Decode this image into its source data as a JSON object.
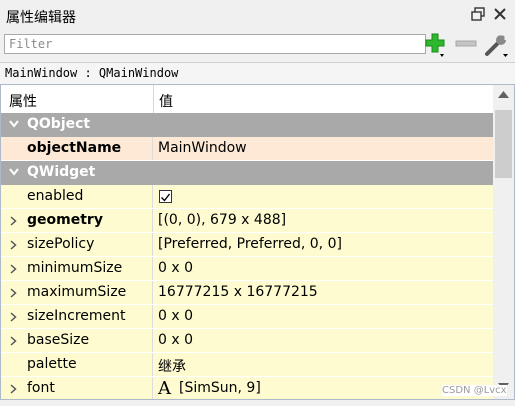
{
  "window": {
    "title": "属性编辑器"
  },
  "toolbar": {
    "filter_placeholder": "Filter"
  },
  "class_path": "MainWindow : QMainWindow",
  "columns": {
    "property": "属性",
    "value": "值"
  },
  "groups": [
    {
      "name": "QObject",
      "items": [
        {
          "name": "objectName",
          "value": "MainWindow",
          "bold": true,
          "expandable": false,
          "bg": "#fde9d6"
        }
      ]
    },
    {
      "name": "QWidget",
      "items": [
        {
          "name": "enabled",
          "value": "",
          "checked": true,
          "bold": false,
          "expandable": false,
          "bg": "#fffbd0"
        },
        {
          "name": "geometry",
          "value": "[(0, 0), 679 x 488]",
          "bold": true,
          "expandable": true,
          "bg": "#fffbd0"
        },
        {
          "name": "sizePolicy",
          "value": "[Preferred, Preferred, 0, 0]",
          "bold": false,
          "expandable": true,
          "bg": "#fffbd0"
        },
        {
          "name": "minimumSize",
          "value": "0 x 0",
          "bold": false,
          "expandable": true,
          "bg": "#fffbd0"
        },
        {
          "name": "maximumSize",
          "value": "16777215 x 16777215",
          "bold": false,
          "expandable": true,
          "bg": "#fffbd0"
        },
        {
          "name": "sizeIncrement",
          "value": "0 x 0",
          "bold": false,
          "expandable": true,
          "bg": "#fffbd0"
        },
        {
          "name": "baseSize",
          "value": "0 x 0",
          "bold": false,
          "expandable": true,
          "bg": "#fffbd0"
        },
        {
          "name": "palette",
          "value": "继承",
          "bold": false,
          "expandable": false,
          "bg": "#fffbd0"
        },
        {
          "name": "font",
          "value": "[SimSun, 9]",
          "font_icon": "A",
          "bold": false,
          "expandable": true,
          "bg": "#fffbd0"
        }
      ]
    }
  ],
  "watermark": "CSDN @Lvcx",
  "colors": {
    "group_header": "#a9a9a9",
    "object_row": "#fde9d6",
    "widget_row": "#fffbd0",
    "add_icon": "#2db82d"
  }
}
